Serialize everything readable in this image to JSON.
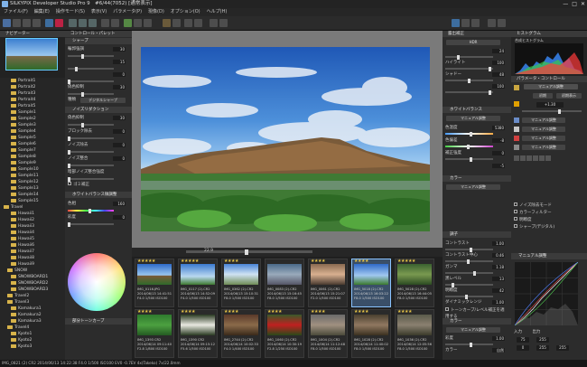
{
  "window": {
    "title": "SILKYPIX Developer Studio Pro 9　#6/44(7052) [通常表示]",
    "controls": [
      "—",
      "□",
      "✕"
    ]
  },
  "menu": [
    "ファイル(F)",
    "編集(E)",
    "操作モード(S)",
    "表示(V)",
    "パラメータ(P)",
    "現像(D)",
    "オプション(O)",
    "ヘルプ(H)"
  ],
  "left": {
    "navigator_title": "ナビゲーター",
    "folders": [
      "Portrait1",
      "Portrait2",
      "Portrait3",
      "Portrait4",
      "Portrait5",
      "Sample1",
      "Sample2",
      "Sample3",
      "Sample4",
      "Sample5",
      "Sample6",
      "Sample7",
      "Sample8",
      "Sample9",
      "Sample10",
      "Sample11",
      "Sample12",
      "Sample13",
      "Sample14",
      "Sample15",
      "Travel",
      "Hawaii1",
      "Hawaii2",
      "Hawaii3",
      "Hawaii4",
      "Hawaii5",
      "Hawaii6",
      "Hawaii7",
      "Hawaii8",
      "Hawaii9",
      "SNOW",
      "SNOWBOARD1",
      "SNOWBOARD2",
      "SNOWBOARD3",
      "Travel2",
      "Travel3",
      "Kamakura1",
      "Kamakura2",
      "Kamakura3",
      "Travel4",
      "Kyoto1",
      "Kyoto2",
      "Kyoto3"
    ]
  },
  "control_panel": {
    "title": "コントロール・パレット",
    "sharpness_title": "シャープ",
    "sharp_rows": [
      {
        "label": "輪郭強調",
        "value": "30"
      },
      {
        "label": "",
        "value": "15"
      },
      {
        "label": "",
        "value": "0"
      },
      {
        "label": "偽色抑制",
        "value": "30"
      }
    ],
    "sharp_mode_label": "種類",
    "sharp_mode_value": "デジタルシャープ",
    "noise_title": "ノイズリダクション",
    "noise_rows": [
      {
        "label": "偽色抑制",
        "value": "30"
      },
      {
        "label": "ブロック除去",
        "value": "0"
      },
      {
        "label": "ノイズ除去",
        "value": "0"
      },
      {
        "label": "ノイズ整合",
        "value": "0"
      }
    ],
    "noise_mode": "暗部ノイズ整合強度",
    "noise_check": "ゴミ補正",
    "wb_title": "ホワイトバランス微調整",
    "wb_rows": [
      {
        "label": "色相",
        "value": "160"
      },
      {
        "label": "彩度",
        "value": "0"
      }
    ],
    "tone_title": "部分トーンカーブ"
  },
  "viewer": {
    "zoom": "22.9"
  },
  "thumbnails": [
    {
      "stars": "★★★★★",
      "name": "IMG_0116.JPG",
      "date": "2014/06/13 14:41:51",
      "exp": "F4.0 1/500 ISO100"
    },
    {
      "stars": "★★★★★",
      "name": "IMG_0117 (2).CR2",
      "date": "2014/06/13 14:52:09",
      "exp": "F4.0 1/500 ISO100"
    },
    {
      "stars": "★★★★",
      "name": "IMG_0362 (2).CR2",
      "date": "2014/06/13 15:10:31",
      "exp": "F8.0 1/500 ISO100"
    },
    {
      "stars": "",
      "name": "IMG_0083 (2).CR2",
      "date": "2014/06/13 15:16:45",
      "exp": "F8.0 1/500 ISO100"
    },
    {
      "stars": "★★★★",
      "name": "IMG_0061 (2).CR2",
      "date": "2014/06/13 15:21:07",
      "exp": "F2.0 1/500 ISO100"
    },
    {
      "stars": "★★★★",
      "name": "IMG_5018 (2).CR2",
      "date": "2014/06/13 16:03:22",
      "exp": "F8.0 1/500 ISO100"
    },
    {
      "stars": "★★★★★",
      "name": "IMG_5028 (2).CR2",
      "date": "2014/06/13 16:44:05",
      "exp": "F8.0 1/500 ISO100"
    },
    {
      "stars": "★★★★",
      "name": "IMG_1393 CR2",
      "date": "2014/06/14 09:11:40",
      "exp": "F2.8 1/800 ISO100"
    },
    {
      "stars": "★★★★",
      "name": "IMG_1390 CR2",
      "date": "2014/06/14 09:15:12",
      "exp": "F5.6 1/500 ISO100"
    },
    {
      "stars": "★★★★",
      "name": "IMG_2744 (2).CR2",
      "date": "2014/06/14 10:02:33",
      "exp": "F4.0 1/400 ISO100"
    },
    {
      "stars": "★★★★",
      "name": "IMG_1060 (2).CR2",
      "date": "2014/06/14 10:30:19",
      "exp": "F2.8 1/250 ISO100"
    },
    {
      "stars": "★★★★",
      "name": "IMG_1004 (2).CR2",
      "date": "2014/06/14 11:12:48",
      "exp": "F8.0 1/500 ISO100"
    },
    {
      "stars": "★★★★",
      "name": "IMG_1028 (2).CR2",
      "date": "2014/06/14 11:40:02",
      "exp": "F8.0 1/500 ISO100"
    },
    {
      "stars": "★★★★",
      "name": "IMG_1036 (2).CR2",
      "date": "2014/06/14 12:05:56",
      "exp": "F8.0 1/500 ISO100"
    }
  ],
  "mid_right": {
    "exposure_title": "露出補正",
    "mode": "HDR",
    "rows": [
      {
        "label": "",
        "value": "24"
      },
      {
        "label": "ハイライト",
        "value": "100"
      },
      {
        "label": "シャドー",
        "value": "48"
      },
      {
        "label": "",
        "value": "100"
      }
    ],
    "wb_title": "ホワイトバランス",
    "wb_mode": "マニュアル調整",
    "wb_rows": [
      {
        "label": "色温度",
        "value": "5380"
      },
      {
        "label": "色偏差",
        "value": "-8"
      },
      {
        "label": "補正強度",
        "value": "0"
      },
      {
        "label": "",
        "value": "-5"
      }
    ],
    "color_title": "カラー",
    "color_mode": "マニュアル調整",
    "tone_title": "調子",
    "tone_rows": [
      {
        "label": "コントラスト",
        "value": "1.00"
      },
      {
        "label": "コントラスト中心",
        "value": "0.46"
      },
      {
        "label": "ガンマ",
        "value": "1.18"
      },
      {
        "label": "黒レベル",
        "value": "13"
      },
      {
        "label": "明瞭度",
        "value": "42"
      },
      {
        "label": "ダイナミックレンジ",
        "value": "1.00"
      }
    ],
    "tone_check": "トーンカーブ/レベル補正を適用する",
    "color2_title": "カラー",
    "color2_mode": "マニュアル調整",
    "color2_rows": [
      {
        "label": "彩度",
        "value": "1.00"
      },
      {
        "label": "カラー",
        "value": "自然"
      }
    ]
  },
  "right": {
    "histogram_title": "ヒストグラム",
    "histogram_sub": "合成ヒストグラム",
    "param_title": "パラメータ・コントロール",
    "manual": "マニュアル調整",
    "tabs": [
      "初期",
      "初期表示"
    ],
    "exposure_value": "+1.30",
    "rows": [
      "マニュアル調整",
      "マニュアル調整",
      "マニュアル調整",
      "マニュアル調整"
    ],
    "checks": [
      "ノイズ除去モード",
      "カラーフィルター",
      "明瞭度",
      "シャープ(デジタル)"
    ],
    "curve_title": "マニュアル調整",
    "curve_input_label": "入力",
    "curve_output_label": "出力",
    "curve_in": "75",
    "curve_out": "255",
    "curve_vals": [
      "0",
      "255",
      "255"
    ]
  },
  "status": "IMG_0821 (2) CR2 2014/06/13 14:22:38 F4.0 1/500 ISO100 EV0 -0.7EV 4x(Takeko) 7x/22.0mm"
}
